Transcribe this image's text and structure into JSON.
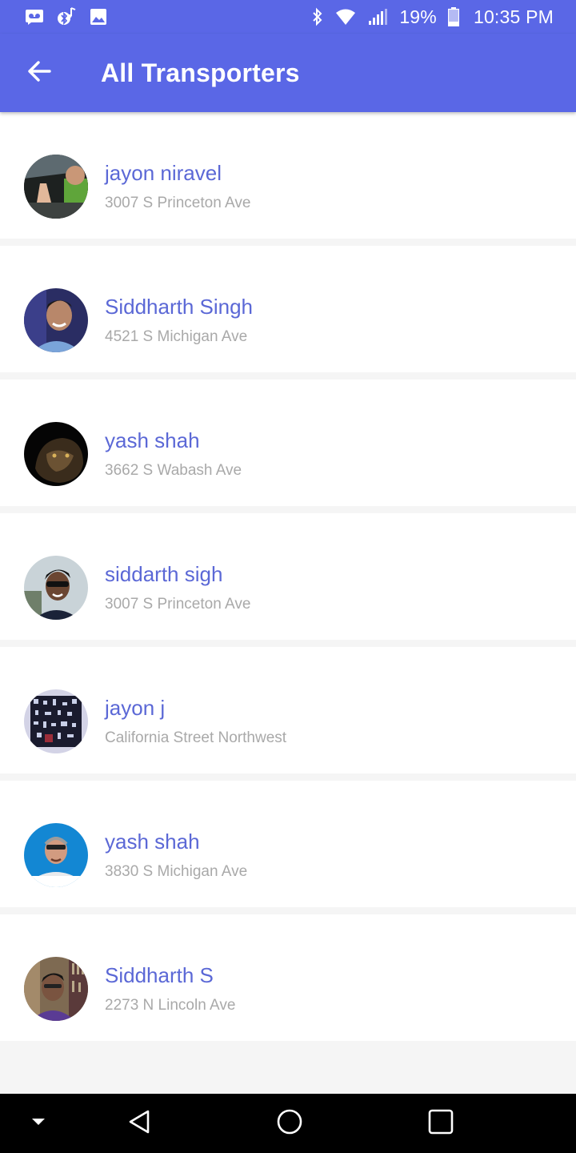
{
  "status_bar": {
    "battery_percent": "19%",
    "time": "10:35 PM",
    "left_icons": [
      "voicemail-icon",
      "bluetooth-music-icon",
      "image-icon"
    ],
    "right_icons": [
      "bluetooth-icon",
      "wifi-icon",
      "signal-icon",
      "battery-icon"
    ]
  },
  "app_bar": {
    "title": "All Transporters",
    "back_icon": "arrow-left-icon",
    "color": "#5a67e6"
  },
  "transporters": [
    {
      "name": "jayon niravel",
      "address": "3007 S Princeton Ave"
    },
    {
      "name": "Siddharth Singh",
      "address": "4521 S Michigan Ave"
    },
    {
      "name": "yash shah",
      "address": "3662 S Wabash Ave"
    },
    {
      "name": "siddarth sigh",
      "address": "3007 S Princeton Ave"
    },
    {
      "name": "jayon j",
      "address": "California Street Northwest"
    },
    {
      "name": "yash shah",
      "address": "3830 S Michigan Ave"
    },
    {
      "name": "Siddharth S",
      "address": "2273 N Lincoln Ave"
    }
  ],
  "nav_bar": {
    "icons": [
      "hide-keyboard-icon",
      "back-triangle-icon",
      "home-circle-icon",
      "recents-square-icon"
    ]
  },
  "colors": {
    "accent": "#5a67e6",
    "name_text": "#5b68d6",
    "address_text": "#a9a9a9"
  }
}
